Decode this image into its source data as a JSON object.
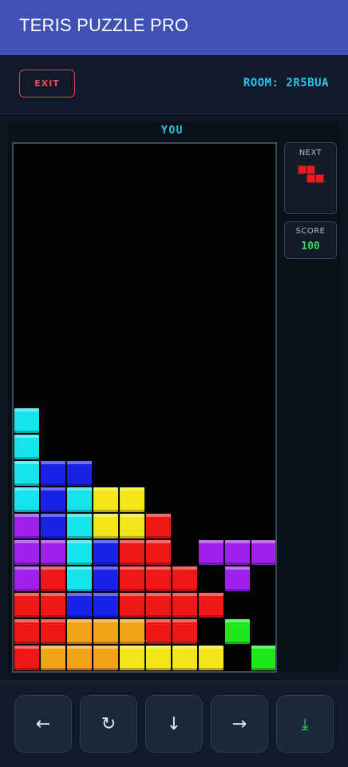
{
  "app": {
    "title": "TERIS PUZZLE PRO"
  },
  "topbar": {
    "exit_label": "EXIT",
    "room_label": "ROOM: 2R5BUA"
  },
  "player": {
    "label": "YOU"
  },
  "next": {
    "label": "NEXT",
    "piece": "Z",
    "color": "#e81c1c"
  },
  "score": {
    "label": "SCORE",
    "value": "100"
  },
  "colors": {
    "C": "#16e4ec",
    "B": "#1a22e6",
    "Y": "#f2e61a",
    "R": "#ee1818",
    "P": "#a020ee",
    "O": "#f2a216",
    "G": "#1ce81c",
    "board_bg": "#020304",
    "accent": "#2ec4e8",
    "exit": "#e05252"
  },
  "board": {
    "columns": 10,
    "rows": 20,
    "grid": [
      "..........",
      "..........",
      "..........",
      "..........",
      "..........",
      "..........",
      "..........",
      "..........",
      "..........",
      "..........",
      "C.........",
      "C.........",
      "CBB.......",
      "CBCYY.....",
      "PBCYYR....",
      "PPCBRR.PPP",
      "PRCBRRR.P.",
      "RRBBRRRR..",
      "RROOORR.G.",
      "ROOOYYYY.G"
    ]
  },
  "controls": {
    "left": "←",
    "rotate": "↻",
    "down": "↓",
    "right": "→",
    "drop": "⤓"
  }
}
